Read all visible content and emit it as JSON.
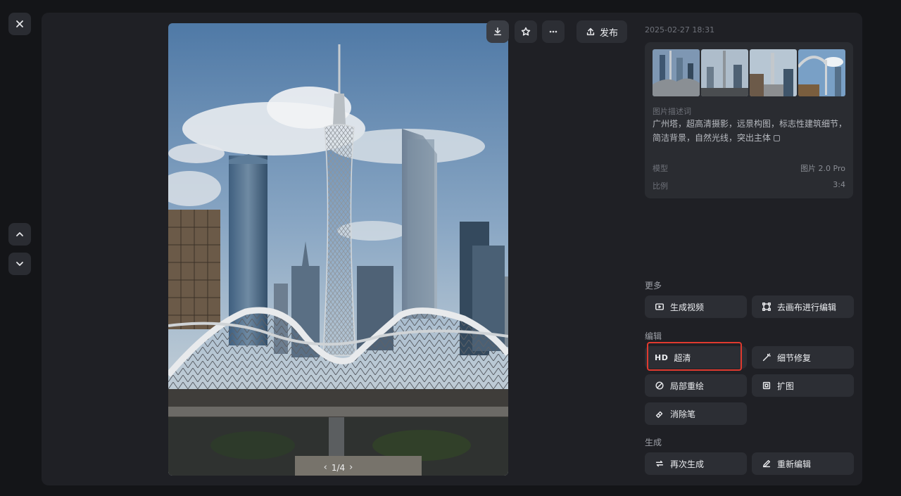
{
  "nav": {
    "close_icon": "close-icon",
    "up_icon": "chevron-up-icon",
    "down_icon": "chevron-down-icon"
  },
  "toolbar": {
    "download_icon": "download-icon",
    "favorite_icon": "star-icon",
    "more_icon": "more-icon",
    "publish_label": "发布"
  },
  "image": {
    "pager": "1/4"
  },
  "info": {
    "timestamp": "2025-02-27 18:31",
    "description_label": "图片描述词",
    "description": "广州塔，超高清摄影，远景构图，标志性建筑细节，简洁背景，自然光线，突出主体",
    "model_label": "模型",
    "model_value": "图片 2.0 Pro",
    "ratio_label": "比例",
    "ratio_value": "3:4"
  },
  "sections": {
    "more": "更多",
    "edit": "编辑",
    "generate": "生成"
  },
  "actions": {
    "generate_video": "生成视频",
    "canvas_edit": "去画布进行编辑",
    "hd_badge": "HD",
    "upscale": "超清",
    "detail_fix": "细节修复",
    "inpaint": "局部重绘",
    "expand": "扩图",
    "eraser": "消除笔",
    "regenerate": "再次生成",
    "re_edit": "重新编辑"
  },
  "colors": {
    "highlight": "#e03a2f",
    "panel": "#1f2025",
    "button": "#2c2e34"
  }
}
